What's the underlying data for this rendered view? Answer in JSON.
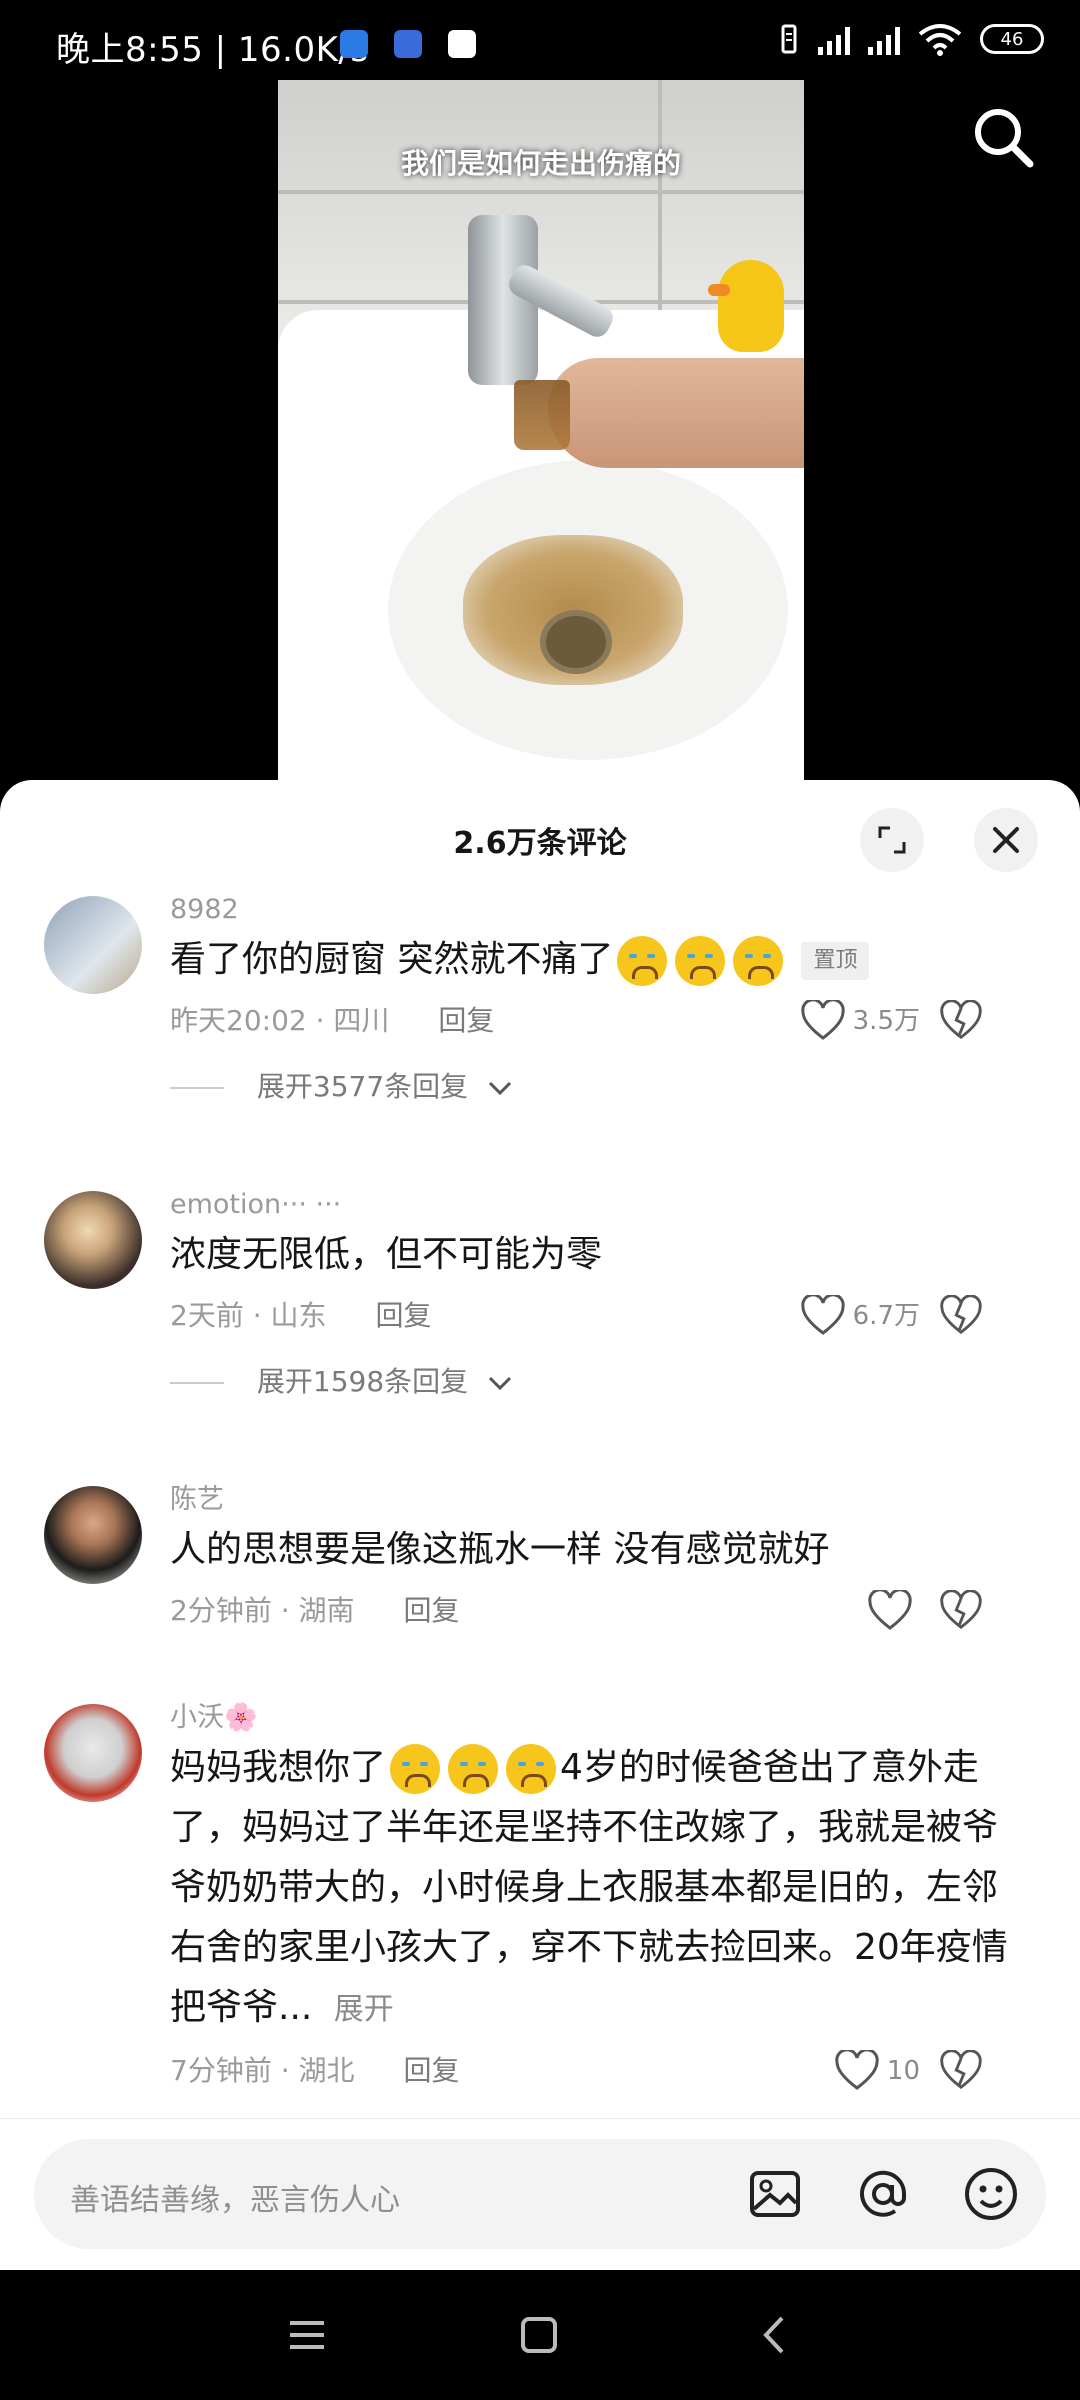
{
  "status_bar": {
    "time_speed": "晚上8:55 | 16.0K/s",
    "battery": "46",
    "app_icons": [
      "location-app-icon",
      "calendar-app-icon",
      "qq-icon"
    ]
  },
  "video": {
    "caption": "我们是如何走出伤痛的"
  },
  "sheet": {
    "title": "2.6万条评论"
  },
  "comments": [
    {
      "username": "8982",
      "text": "看了你的厨窗  突然就不痛了",
      "emoji_count": 3,
      "pinned_label": "置顶",
      "time_location": "昨天20:02 · 四川",
      "reply_label": "回复",
      "likes": "3.5万",
      "expand_label": "展开3577条回复"
    },
    {
      "username": "emotion··· ···",
      "text": "浓度无限低，但不可能为零",
      "time_location": "2天前 · 山东",
      "reply_label": "回复",
      "likes": "6.7万",
      "expand_label": "展开1598条回复"
    },
    {
      "username": "陈艺",
      "text": "人的思想要是像这瓶水一样 没有感觉就好",
      "time_location": "2分钟前 · 湖南",
      "reply_label": "回复",
      "likes": ""
    },
    {
      "username": "小沃🌸",
      "text_before": "妈妈我想你了",
      "text_after": "4岁的时候爸爸出了意外走了，妈妈过了半年还是坚持不住改嫁了，我就是被爷爷奶奶带大的，小时候身上衣服基本都是旧的，左邻右舍的家里小孩大了，穿不下就去捡回来。20年疫情把爷爷...",
      "more_label": "展开",
      "time_location": "7分钟前 · 湖北",
      "reply_label": "回复",
      "likes": "10"
    }
  ],
  "input": {
    "placeholder": "善语结善缘，恶言伤人心"
  }
}
